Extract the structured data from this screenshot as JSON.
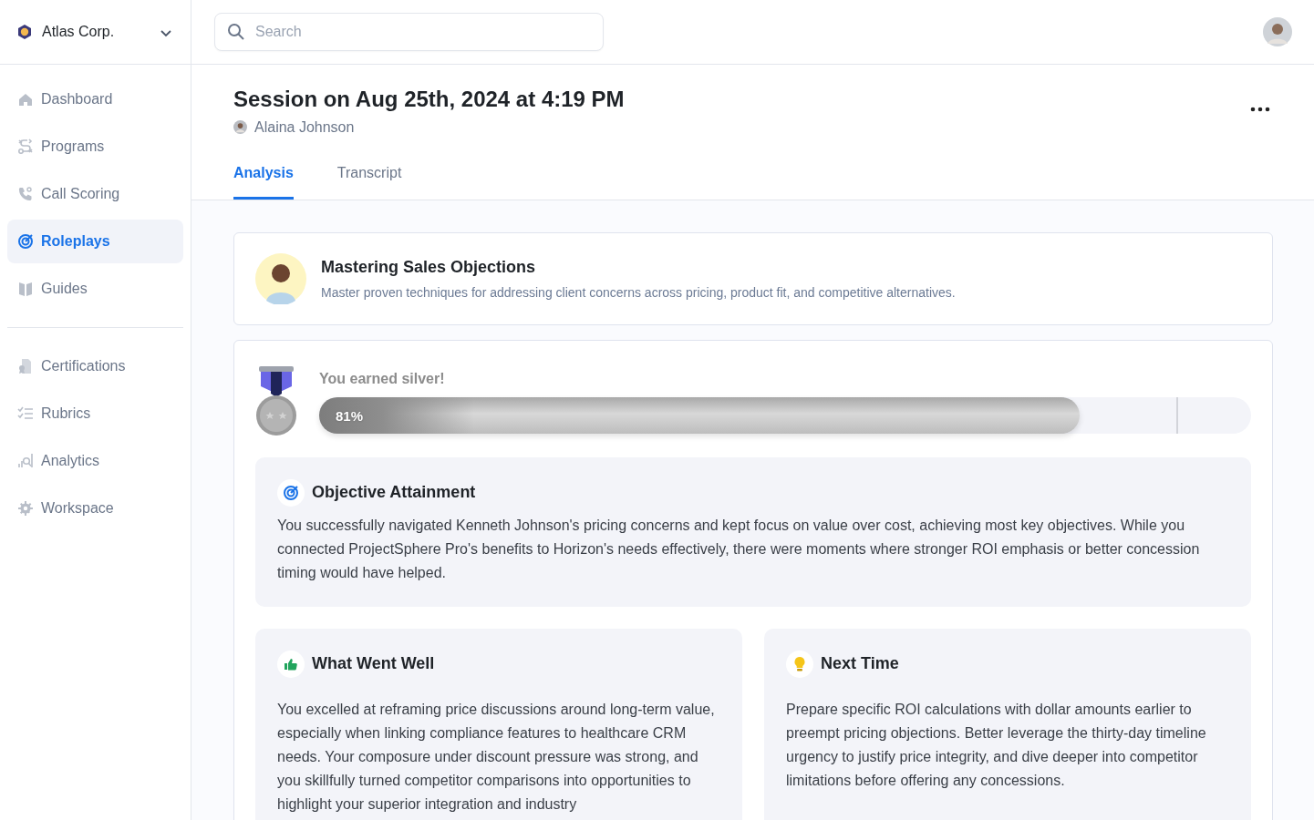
{
  "org": {
    "name": "Atlas Corp."
  },
  "search": {
    "placeholder": "Search"
  },
  "sidebar": {
    "groups": [
      [
        {
          "label": "Dashboard",
          "selected": false
        },
        {
          "label": "Programs",
          "selected": false
        },
        {
          "label": "Call Scoring",
          "selected": false
        },
        {
          "label": "Roleplays",
          "selected": true
        },
        {
          "label": "Guides",
          "selected": false
        }
      ],
      [
        {
          "label": "Certifications",
          "selected": false
        },
        {
          "label": "Rubrics",
          "selected": false
        },
        {
          "label": "Analytics",
          "selected": false
        },
        {
          "label": "Workspace",
          "selected": false
        }
      ]
    ]
  },
  "session": {
    "title": "Session on Aug 25th, 2024 at 4:19 PM",
    "user": "Alaina Johnson"
  },
  "tabs": [
    {
      "label": "Analysis",
      "selected": true
    },
    {
      "label": "Transcript",
      "selected": false
    }
  ],
  "scenario": {
    "title": "Mastering Sales Objections",
    "description": "Master proven techniques for addressing client concerns across pricing, product fit, and competitive alternatives."
  },
  "result": {
    "heading": "You earned silver!",
    "reading": "81%",
    "level": 0.816
  },
  "objective": {
    "title": "Objective Attainment",
    "text": "You successfully navigated Kenneth Johnson's pricing concerns and kept focus on value over cost, achieving most key objectives. While you connected ProjectSphere Pro's benefits to Horizon's needs effectively, there were moments where stronger ROI emphasis or better concession timing would have helped."
  },
  "feedback": [
    {
      "kind": "well",
      "title": "What Went Well",
      "text": "You excelled at reframing price discussions around long-term value, especially when linking compliance features to healthcare CRM needs. Your composure under discount pressure was strong, and you skillfully turned competitor comparisons into opportunities to highlight your superior integration and industry"
    },
    {
      "kind": "next",
      "title": "Next Time",
      "text": "Prepare specific ROI calculations with dollar amounts earlier to preempt pricing objections. Better leverage the thirty-day timeline urgency to justify price integrity, and dive deeper into competitor limitations before offering any concessions."
    }
  ]
}
